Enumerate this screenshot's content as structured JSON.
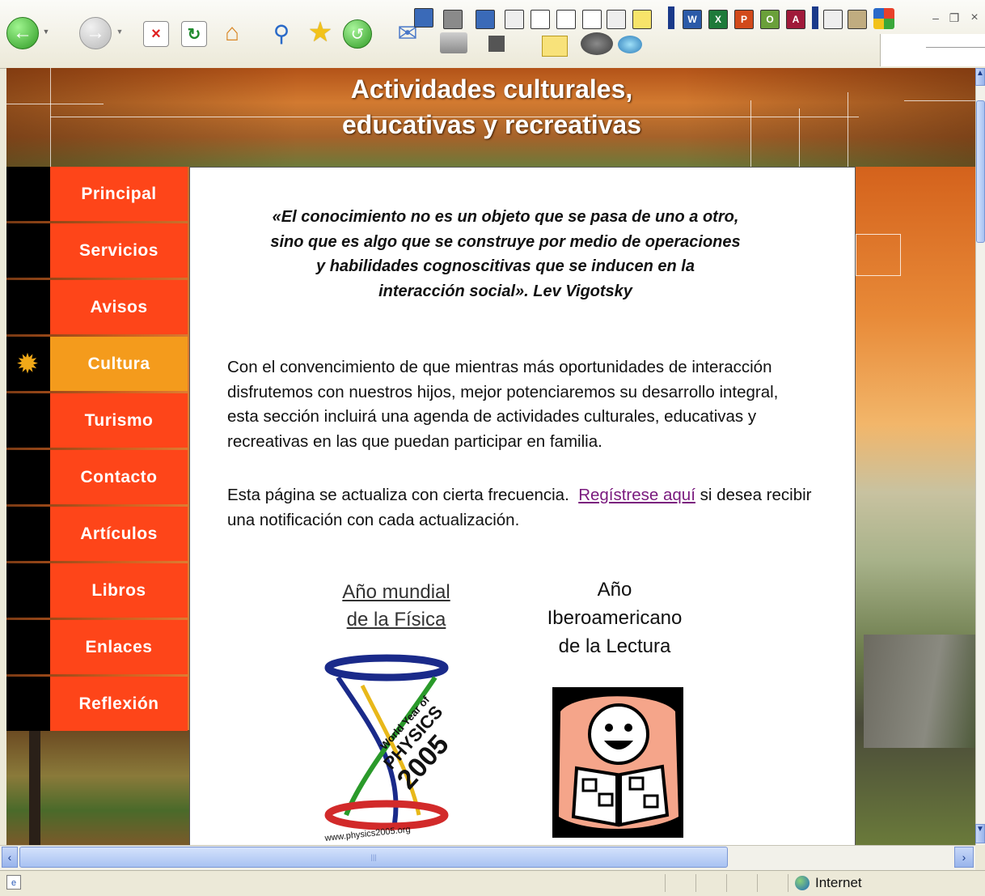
{
  "page": {
    "title": "Actividades culturales,\neducativas y recreativas"
  },
  "nav": {
    "items": [
      {
        "label": "Principal"
      },
      {
        "label": "Servicios"
      },
      {
        "label": "Avisos"
      },
      {
        "label": "Cultura",
        "active": true
      },
      {
        "label": "Turismo"
      },
      {
        "label": "Contacto"
      },
      {
        "label": "Artículos"
      },
      {
        "label": "Libros"
      },
      {
        "label": "Enlaces"
      },
      {
        "label": "Reflexión"
      }
    ]
  },
  "content": {
    "quote": "«El conocimiento no es un objeto que se pasa de uno a otro,\nsino que es algo que se construye por medio de operaciones\ny habilidades cognoscitivas que se inducen en la\ninteracción social». Lev Vigotsky",
    "intro": "Con el convencimiento de que mientras más oportunidades de interacción\ndisfrutemos con nuestros hijos, mejor potenciaremos su desarrollo integral,\nesta sección incluirá una agenda de actividades culturales, educativas y\nrecreativas en las que puedan participar en familia.",
    "update_before": "Esta página se actualiza con cierta frecuencia.",
    "update_link": "Regístrese aquí",
    "update_after": "si desea recibir una notificación con cada actualización.",
    "physics_title": "Año mundial\nde la Física",
    "physics_logo_text": [
      "World Year of",
      "PHYSICS",
      "2005"
    ],
    "physics_url": "www.physics2005.org",
    "reading_title": "Año\nIberoamericano\nde la Lectura"
  },
  "statusbar": {
    "zone": "Internet"
  },
  "toolbar": {
    "icons": [
      "back-icon",
      "forward-icon",
      "stop-icon",
      "refresh-icon",
      "home-icon",
      "search-icon",
      "favorites-icon",
      "history-icon",
      "mail-icon",
      "print-icon",
      "edit-icon",
      "word-icon",
      "excel-icon",
      "powerpoint-icon",
      "access-icon",
      "outlook-icon",
      "publisher-icon",
      "onenote-icon",
      "messenger-icon",
      "windows-flag-icon"
    ]
  },
  "colors": {
    "nav_button": "#fe4519",
    "nav_active": "#f49b1c",
    "link_visited": "#7a1a7e"
  }
}
